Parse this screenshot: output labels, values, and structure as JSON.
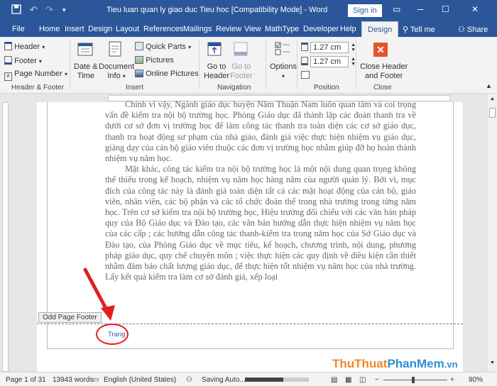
{
  "window": {
    "title": "Tieu luan quan ly giao duc Tieu hoc [Compatibility Mode] - Word",
    "sign_in": "Sign in",
    "minimize": "─",
    "restore": "☐",
    "close": "✕"
  },
  "tabs": [
    "File",
    "Home",
    "Insert",
    "Design",
    "Layout",
    "References",
    "Mailings",
    "Review",
    "View",
    "MathType",
    "Developer",
    "Help",
    "Design"
  ],
  "tell_me": "Tell me",
  "share": "Share",
  "ribbon": {
    "header_footer": {
      "header": "Header",
      "footer": "Footer",
      "page_number": "Page Number",
      "group": "Header & Footer"
    },
    "insert": {
      "date_time": [
        "Date &",
        "Time"
      ],
      "doc_info": [
        "Document",
        "Info"
      ],
      "quick_parts": "Quick Parts",
      "pictures": "Pictures",
      "online_pictures": "Online Pictures",
      "group": "Insert"
    },
    "navigation": {
      "goto_header": [
        "Go to",
        "Header"
      ],
      "goto_footer": [
        "Go to",
        "Footer"
      ],
      "group": "Navigation"
    },
    "options": {
      "label": "Options"
    },
    "position": {
      "top": "1.27 cm",
      "bottom": "1.27 cm",
      "group": "Position"
    },
    "close": {
      "label": [
        "Close Header",
        "and Footer"
      ],
      "group": "Close"
    }
  },
  "document": {
    "paragraphs": [
      "Chính vì vậy, Ngành giáo dục huyện Năm Thuận Nam luôn quan tâm và coi trọng vấn đề kiểm tra nội bộ trường học. Phòng Giáo dục đã thành lập các đoàn thanh tra về dưới cơ sở đơn vị trường học để làm công tác thanh tra toàn diện các cơ sở giáo dục, thanh tra hoạt động sư phạm của nhà giáo, đánh giá việc thực hiện nhiệm vụ giáo dục, giảng dạy của cán bộ giáo viên thuộc các đơn vị trường học nhằm giúp đỡ họ hoàn thành nhiệm vụ năm học.",
      "Mặt khác, công tác kiểm tra nội bộ trường học là một nội dung quan trọng không thể thiếu trong kế hoạch, nhiệm vụ năm học hàng năm của người quản lý. Bởi vì, mục đích của công tác này là đánh giá toàn diện tất cả các mặt hoạt động của cán bộ, giáo viên, nhân viên, các bộ phận và các tổ chức đoàn thể trong nhà trường trong từng năm học. Trên cơ sở kiểm tra nội bộ trường học, Hiệu trưởng đối chiếu với các văn bản pháp quy của Bộ Giáo dục và Đào tạo, các văn bản hướng dẫn thực hiện nhiệm vụ năm học của các cấp ; các hướng dẫn công tác thanh-kiểm tra trong năm học của Sở Giáo dục và Đào tạo, của Phòng Giáo dục về mục tiêu, kế hoạch, chương trình, nội dung, phương pháp giáo dục, quy chế chuyên môn ; việc thực hiện các quy định về điều kiện cần thiết nhằm đảm bảo chất lượng giáo dục, để thực hiện tốt nhiệm vụ năm học của nhà trường. Lấy kết quả kiểm tra làm cơ sở đánh giá, xếp loại"
    ],
    "footer_label": "Odd Page Footer",
    "footer_text": "Trang"
  },
  "status": {
    "page": "Page 1 of 31",
    "words": "13943 words",
    "language": "English (United States)",
    "saving": "Saving Auto...",
    "zoom": "90%"
  },
  "watermark": {
    "a": "Thu",
    "b": "Thuat",
    "c": "PhanMem",
    ".vn": ".vn"
  },
  "colors": {
    "accent": "#2b579a",
    "annotation": "#e02020"
  }
}
